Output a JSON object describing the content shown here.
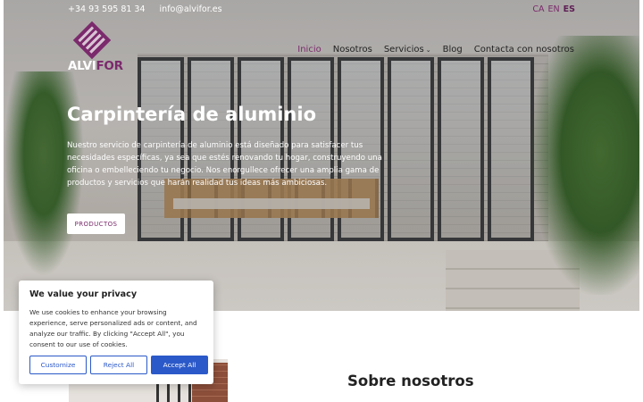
{
  "topbar": {
    "phone": "+34 93 595 81 34",
    "email": "info@alvifor.es",
    "languages": [
      "CA",
      "EN",
      "ES"
    ],
    "active_language": "ES"
  },
  "logo": {
    "text_main": "ALVI",
    "text_accent": "FOR"
  },
  "nav": {
    "items": [
      "Inicio",
      "Nosotros",
      "Servicios",
      "Blog",
      "Contacta con nosotros"
    ],
    "active": "Inicio",
    "dropdown_item": "Servicios"
  },
  "hero": {
    "title": "Carpintería de aluminio",
    "text": "Nuestro servicio de carpintería de aluminio está diseñado para satisfacer tus necesidades específicas, ya sea que estés renovando tu hogar, construyendo una oficina o embelleciendo tu negocio. Nos enorgullece ofrecer una amplia gama de productos y servicios que harán realidad tus ideas más ambiciosas.",
    "button": "PRODUCTOS"
  },
  "about": {
    "title": "Sobre nosotros"
  },
  "cookie": {
    "title": "We value your privacy",
    "text": "We use cookies to enhance your browsing experience, serve personalized ads or content, and analyze our traffic. By clicking \"Accept All\", you consent to our use of cookies.",
    "customize": "Customize",
    "reject": "Reject All",
    "accept": "Accept All"
  },
  "colors": {
    "brand": "#7b2a6c",
    "cookie_button": "#2b59c9"
  },
  "icons": {
    "dropdown": "chevron-down-icon"
  }
}
